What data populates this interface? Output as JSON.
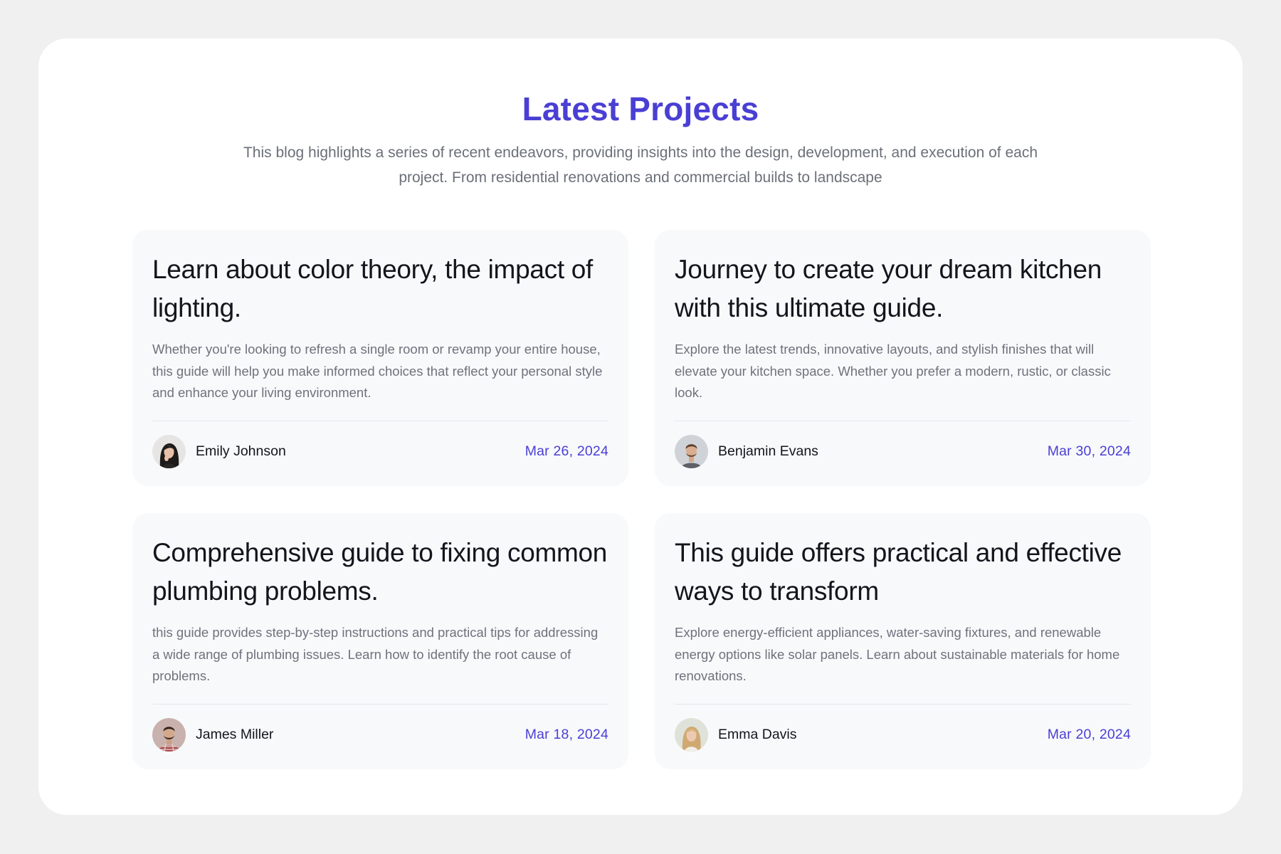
{
  "section": {
    "title": "Latest Projects",
    "subtitle": "This blog highlights a series of recent endeavors, providing insights into the design, development, and execution of each project. From residential renovations and commercial builds to landscape"
  },
  "colors": {
    "accent": "#4a3fd4",
    "title_text": "#13151c",
    "body_text": "#6e727b",
    "card_background": "#f8f9fb",
    "page_background": "#f0f0f0"
  },
  "posts": [
    {
      "title": "Learn about color theory, the impact of lighting.",
      "excerpt": "Whether you're looking to refresh a single room or revamp your entire house, this guide will help you make informed choices that reflect your personal style and enhance your living environment.",
      "author": "Emily Johnson",
      "date": "Mar 26, 2024",
      "avatar_icon": "woman-dark-hair-avatar"
    },
    {
      "title": "Journey to create your dream kitchen with this ultimate guide.",
      "excerpt": "Explore the latest trends, innovative layouts, and stylish finishes that will elevate your kitchen space. Whether you prefer a modern, rustic, or classic look.",
      "author": "Benjamin Evans",
      "date": "Mar 30, 2024",
      "avatar_icon": "man-beard-avatar"
    },
    {
      "title": "Comprehensive guide to fixing common plumbing problems.",
      "excerpt": "this guide provides step-by-step instructions and practical tips for addressing a wide range of plumbing issues. Learn how to identify the root cause of problems.",
      "author": "James Miller",
      "date": "Mar 18, 2024",
      "avatar_icon": "man-checkered-shirt-avatar"
    },
    {
      "title": "This guide offers practical and effective ways to transform",
      "excerpt": "Explore energy-efficient appliances, water-saving fixtures, and renewable energy options like solar panels. Learn about sustainable materials for home renovations.",
      "author": "Emma Davis",
      "date": "Mar 20, 2024",
      "avatar_icon": "woman-blonde-hair-avatar"
    }
  ]
}
